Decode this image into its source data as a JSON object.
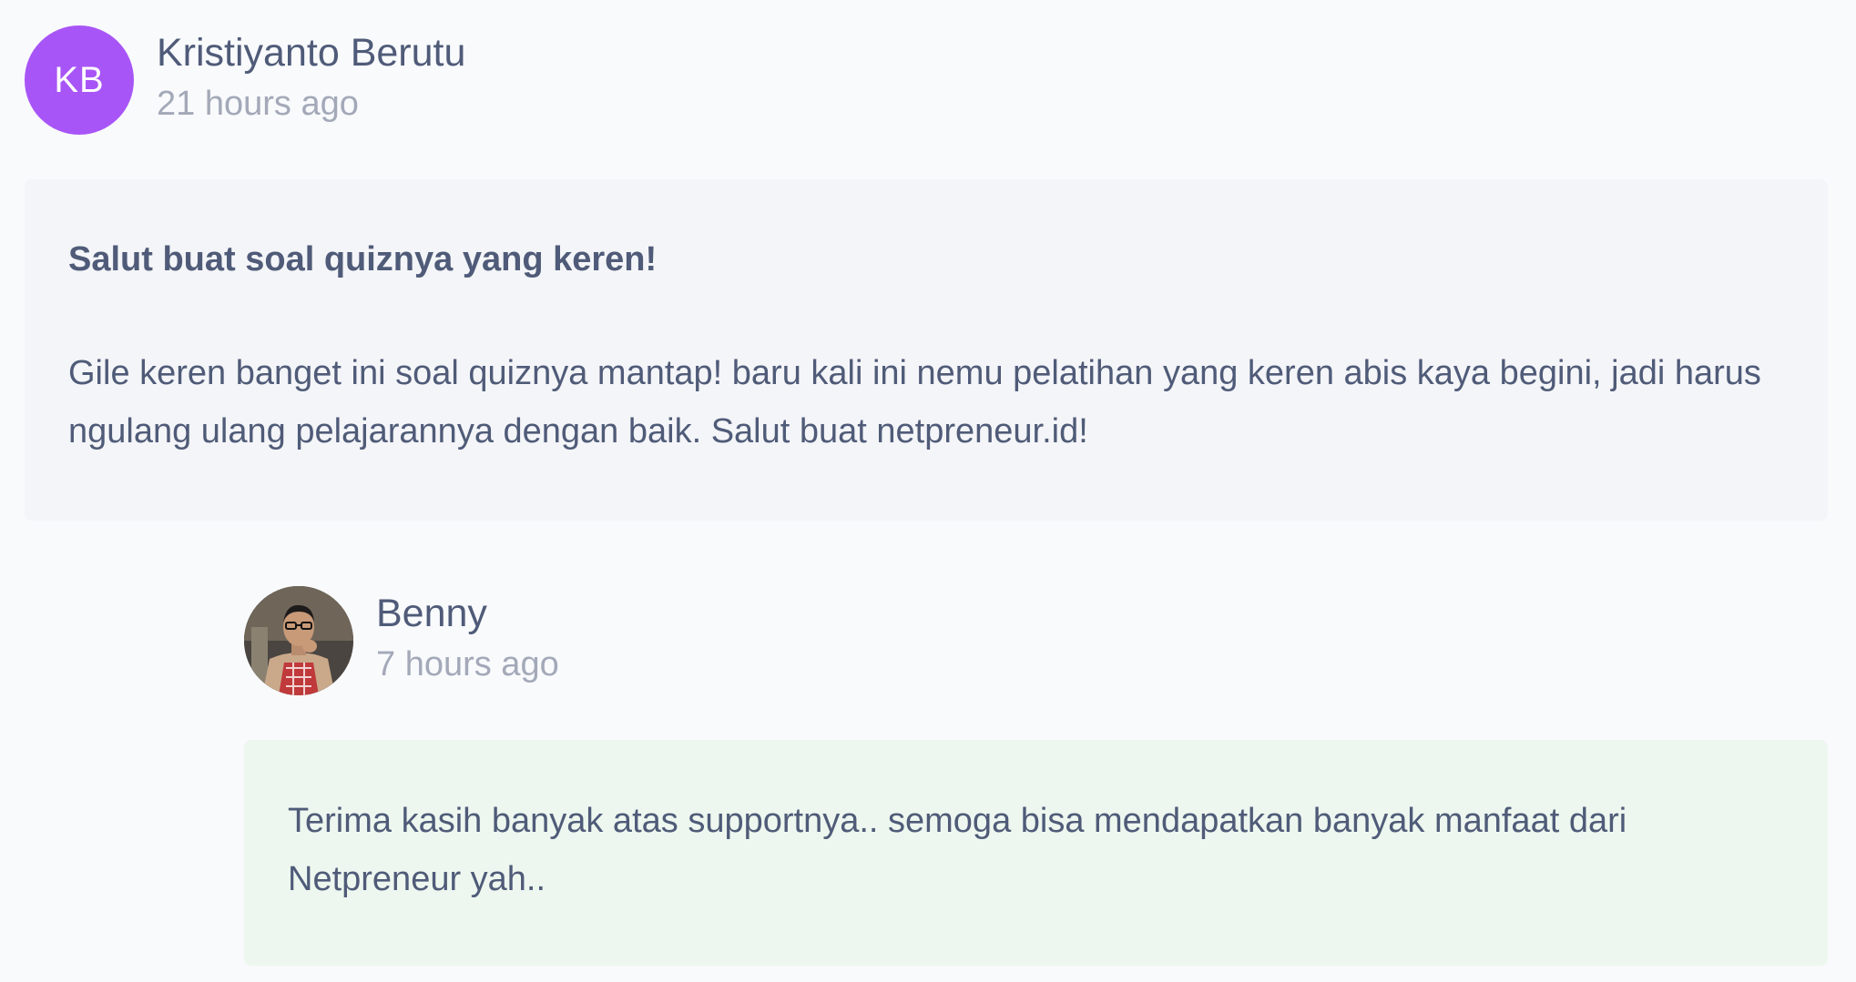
{
  "comment": {
    "author": "Kristiyanto Berutu",
    "initials": "KB",
    "time": "21 hours ago",
    "title": "Salut buat soal quiznya yang keren!",
    "body": "Gile keren banget ini soal quiznya mantap! baru kali ini nemu pelatihan yang keren abis kaya begini, jadi harus ngulang ulang pelajarannya dengan baik. Salut buat netpreneur.id!",
    "avatar_color": "#a855f7"
  },
  "reply": {
    "author": "Benny",
    "time": "7 hours ago",
    "body": "Terima kasih banyak atas supportnya.. semoga bisa mendapatkan banyak manfaat dari Netpreneur yah..",
    "background_color": "#edf7ef"
  }
}
